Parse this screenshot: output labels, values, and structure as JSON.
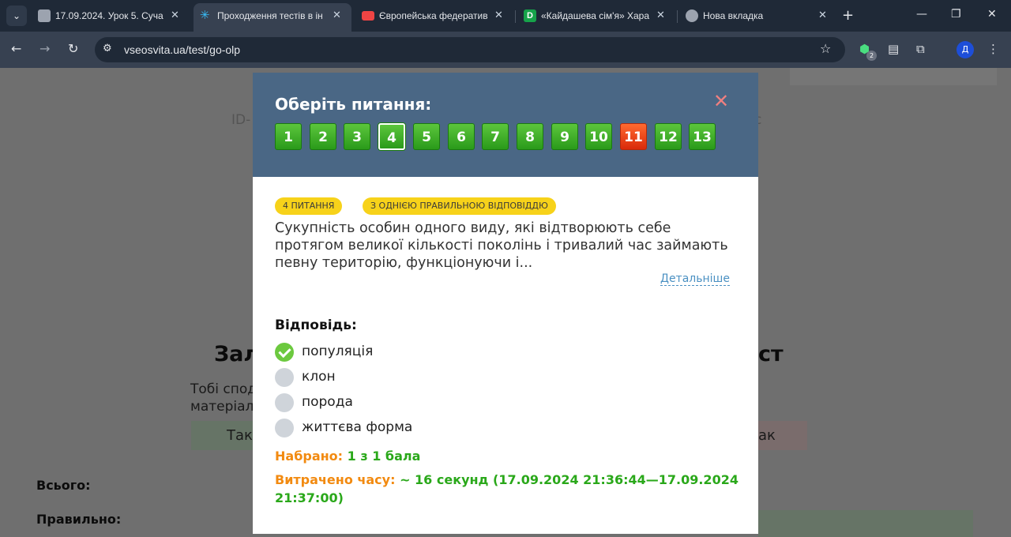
{
  "browser": {
    "tabs": [
      {
        "title": "17.09.2024. Урок 5. Суча",
        "favicon": "classroom-icon",
        "active": false
      },
      {
        "title": "Проходження тестів в ін",
        "favicon": "vseosvita-icon",
        "active": true
      },
      {
        "title": "Європейська федератив",
        "favicon": "youtube-icon",
        "active": false
      },
      {
        "title": "«Кайдашева сім'я» Хара",
        "favicon": "d-icon",
        "active": false
      },
      {
        "title": "Нова вкладка",
        "favicon": "chrome-icon",
        "active": false
      }
    ],
    "url": "vseosvita.ua/test/go-olp",
    "extension_badge": "2",
    "profile_initial": "Д"
  },
  "background": {
    "id_fragment": "ID-",
    "right_fragment": "с",
    "title_left": "Зал",
    "title_right": "ст",
    "line1": "Тобі спод",
    "line2": "матеріал",
    "btn_left": "Так",
    "btn_right": "ак",
    "total_label": "Всього:",
    "correct_label": "Правильно:"
  },
  "modal": {
    "title": "Оберіть питання:",
    "questions": [
      {
        "n": "1",
        "status": "ok"
      },
      {
        "n": "2",
        "status": "ok"
      },
      {
        "n": "3",
        "status": "ok"
      },
      {
        "n": "4",
        "status": "ok",
        "current": true
      },
      {
        "n": "5",
        "status": "ok"
      },
      {
        "n": "6",
        "status": "ok"
      },
      {
        "n": "7",
        "status": "ok"
      },
      {
        "n": "8",
        "status": "ok"
      },
      {
        "n": "9",
        "status": "ok"
      },
      {
        "n": "10",
        "status": "ok"
      },
      {
        "n": "11",
        "status": "bad"
      },
      {
        "n": "12",
        "status": "ok"
      },
      {
        "n": "13",
        "status": "ok"
      }
    ],
    "tag_number": "4 ПИТАННЯ",
    "tag_type": "З ОДНІЄЮ ПРАВИЛЬНОЮ ВІДПОВІДДЮ",
    "question_text": "Сукупність особин одного виду, які відтворюють себе протягом великої кількості поколінь і тривалий час займають певну територію, функціонуючи і...",
    "more_link": "Детальніше",
    "answer_label": "Відповідь:",
    "options": [
      {
        "label": "популяція",
        "checked": true
      },
      {
        "label": "клон",
        "checked": false
      },
      {
        "label": "порода",
        "checked": false
      },
      {
        "label": "життєва форма",
        "checked": false
      }
    ],
    "score_label": "Набрано:",
    "score_value": "1 з 1 бала",
    "time_label": "Витрачено часу:",
    "time_value": "~ 16 секунд (17.09.2024 21:36:44—17.09.2024 21:37:00)"
  },
  "colors": {
    "header_bg": "#4a6785",
    "correct_green": "#2aa81a",
    "label_orange": "#f28a10",
    "wrong_red": "#e8401a",
    "tag_yellow": "#f7d21a"
  }
}
